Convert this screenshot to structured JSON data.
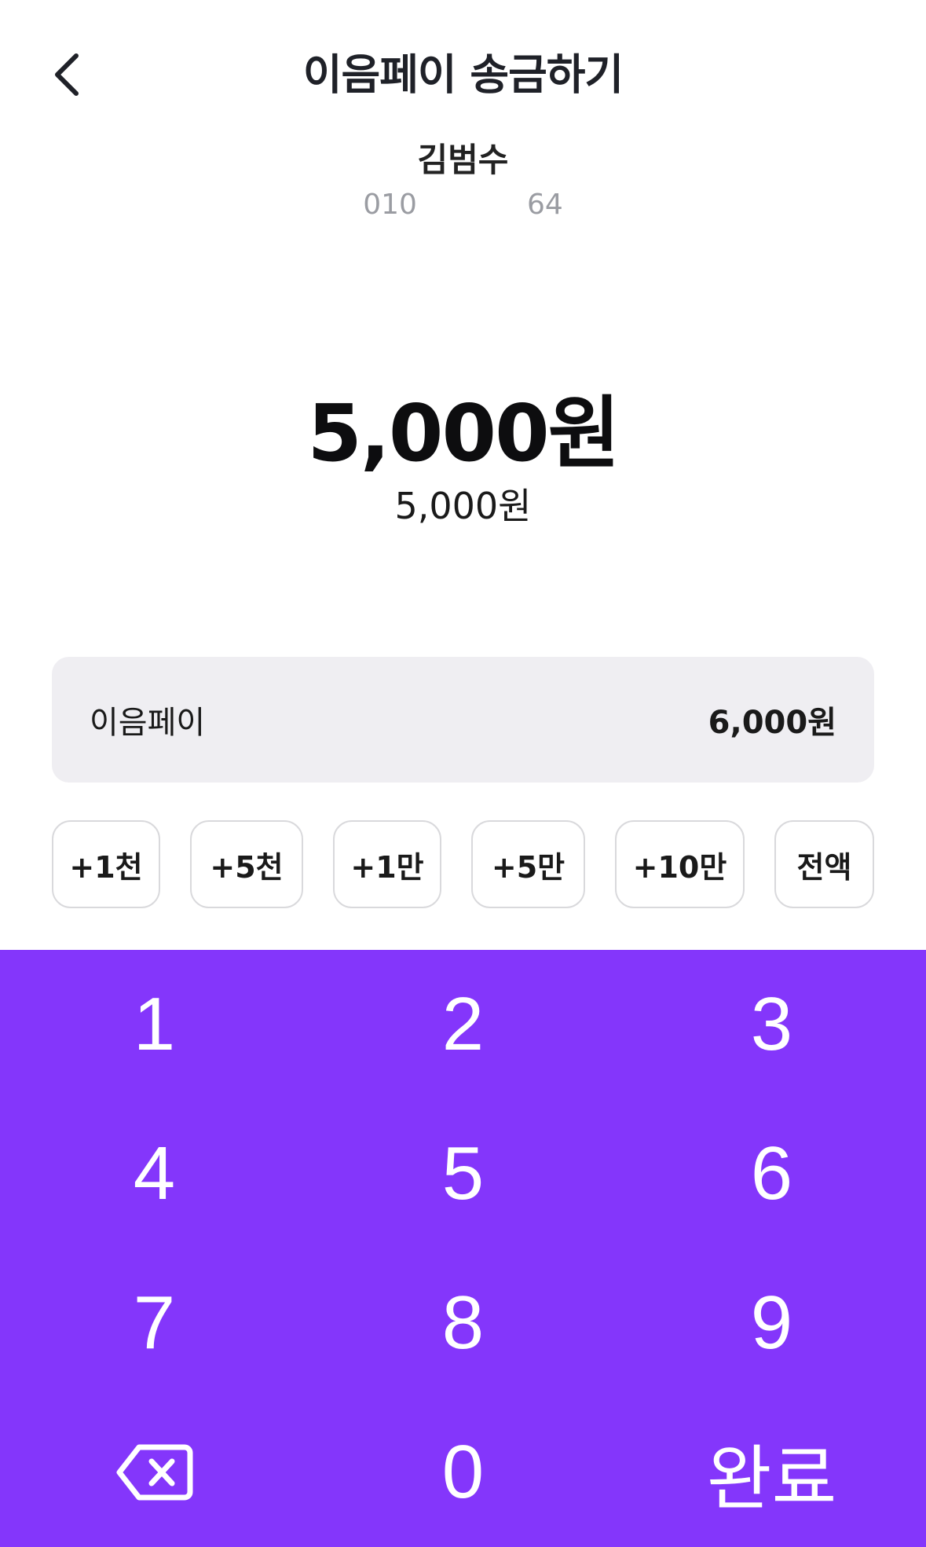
{
  "header": {
    "title": "이음페이 송금하기",
    "back_icon": "chevron-left-icon"
  },
  "recipient": {
    "name": "김범수",
    "phone_prefix": "010",
    "phone_suffix": "64"
  },
  "amount": {
    "main": "5,000원",
    "sub": "5,000원"
  },
  "balance": {
    "label": "이음페이",
    "value": "6,000원"
  },
  "quick_buttons": [
    "+1천",
    "+5천",
    "+1만",
    "+5만",
    "+10만",
    "전액"
  ],
  "keypad": {
    "keys": [
      "1",
      "2",
      "3",
      "4",
      "5",
      "6",
      "7",
      "8",
      "9",
      "0"
    ],
    "done_label": "완료",
    "backspace_icon": "backspace-icon"
  },
  "colors": {
    "keypad_bg": "#8436fb",
    "card_bg": "#efeef2",
    "muted_text": "#9a9ca2"
  }
}
